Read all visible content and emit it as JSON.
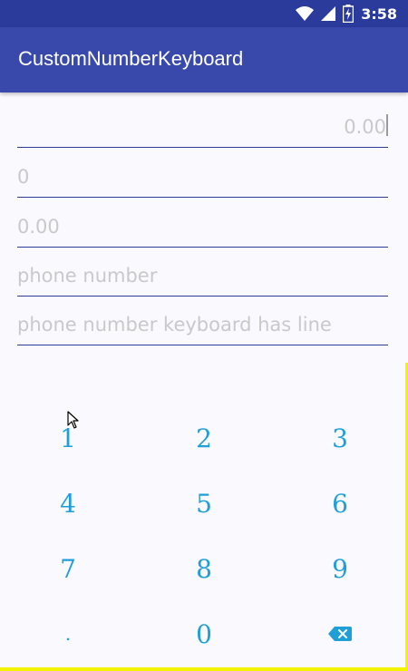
{
  "status_bar": {
    "time": "3:58",
    "icons": [
      "wifi-icon",
      "signal-icon",
      "battery-charging-icon"
    ]
  },
  "app_bar": {
    "title": "CustomNumberKeyboard"
  },
  "fields": [
    {
      "text": "0.00",
      "align": "right"
    },
    {
      "text": "0",
      "align": "left"
    },
    {
      "text": "0.00",
      "align": "left"
    },
    {
      "text": "phone number",
      "align": "left"
    },
    {
      "text": "phone number keyboard has line",
      "align": "left"
    }
  ],
  "keyboard": {
    "keys": [
      "1",
      "2",
      "3",
      "4",
      "5",
      "6",
      "7",
      "8",
      "9",
      ".",
      "0",
      "backspace"
    ]
  },
  "colors": {
    "status_bar": "#2b3b9b",
    "app_bar": "#3949ab",
    "key_text": "#1e9fd8",
    "hint_text": "#c9c9c9",
    "underline": "#2b3b9b"
  }
}
